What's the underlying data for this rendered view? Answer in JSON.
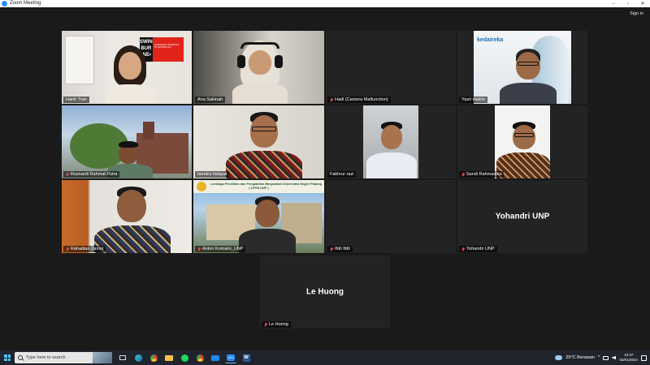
{
  "window": {
    "title": "Zoom Meeting",
    "controls": [
      "–",
      "▫",
      "✕"
    ]
  },
  "header": {
    "sign_in": "Sign in"
  },
  "participants": [
    {
      "name": "Hanh Tran",
      "muted": false
    },
    {
      "name": "Ana Sakinah",
      "muted": false,
      "active_speaker": true
    },
    {
      "name": "Hadi (Camera Malfunction)",
      "muted": true
    },
    {
      "name": "Yasri Hakim",
      "muted": false
    },
    {
      "name": "Rusnardi Rahmat Putra",
      "muted": true
    },
    {
      "name": "hendra hidayat",
      "muted": false
    },
    {
      "name": "Fakhrur razi",
      "muted": false
    },
    {
      "name": "Sandi Rahmadika",
      "muted": true
    },
    {
      "name": "Rahadian Zainul",
      "muted": true
    },
    {
      "name": "Anton Komaini_UNP",
      "muted": true
    },
    {
      "name": "Ifdil Ifdil",
      "muted": true
    },
    {
      "name": "Yohandri UNP",
      "muted": true,
      "camera_off_name": "Yohandri UNP"
    },
    {
      "name": "Le Huong",
      "muted": true,
      "camera_off_name": "Le Huong"
    }
  ],
  "backgrounds": {
    "swinburne_logo": [
      "SWIN",
      "BUR",
      "•NE•"
    ],
    "swinburne_sub": "SWINBURNE UNIVERSITY OF TECHNOLOGY",
    "kedaireka_logo": "kedaireka",
    "lppm_banner_line1": "Lembaga Penelitian dan Pengabdian Masyarakat Universitas Negeri Padang",
    "lppm_banner_line2": "( LPPM UNP )"
  },
  "taskbar": {
    "search_placeholder": "Type here to search",
    "apps": [
      "task-view",
      "edge",
      "chrome-like",
      "file-explorer",
      "spotify",
      "chrome",
      "mail",
      "zoom",
      "word"
    ],
    "weather": "29°C  Berawan",
    "time": "10:37",
    "date": "03/01/2024"
  },
  "colors": {
    "background": "#1a1a1a",
    "tile": "#232323",
    "active_border": "#b4d334",
    "muted_red": "#e5484d",
    "taskbar": "#20242c"
  }
}
